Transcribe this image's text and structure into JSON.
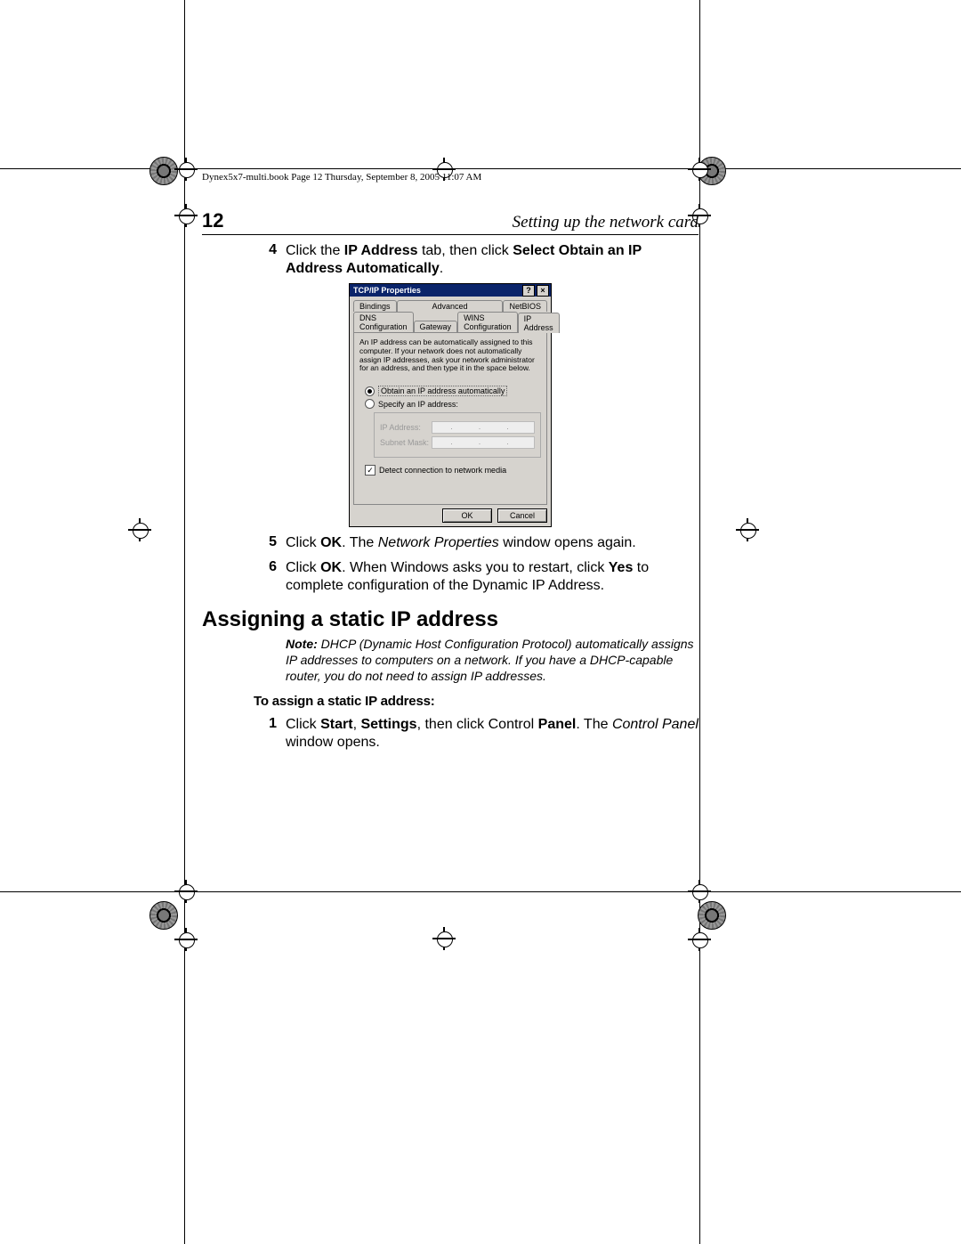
{
  "bookline": "Dynex5x7-multi.book  Page 12  Thursday, September 8, 2005  11:07 AM",
  "header": {
    "page_number": "12",
    "section_title": "Setting up the network card"
  },
  "step4": {
    "number": "4",
    "pre": "Click the ",
    "bold1": "IP Address",
    "mid": " tab, then click ",
    "bold2": "Select Obtain an IP Address Automatically",
    "post": "."
  },
  "dialog": {
    "title": "TCP/IP Properties",
    "help_btn": "?",
    "close_btn": "×",
    "tabs_row1": [
      "Bindings",
      "Advanced",
      "NetBIOS"
    ],
    "tabs_row2": [
      "DNS Configuration",
      "Gateway",
      "WINS Configuration",
      "IP Address"
    ],
    "active_tab": "IP Address",
    "desc": "An IP address can be automatically assigned to this computer. If your network does not automatically assign IP addresses, ask your network administrator for an address, and then type it in the space below.",
    "radio_auto": "Obtain an IP address automatically",
    "radio_specify": "Specify an IP address:",
    "field_ip": "IP Address:",
    "field_mask": "Subnet Mask:",
    "placeholder_dots": ". . .",
    "check_detect": "Detect connection to network media",
    "ok": "OK",
    "cancel": "Cancel"
  },
  "step5": {
    "number": "5",
    "pre": "Click ",
    "bold1": "OK",
    "mid": ". The ",
    "ital1": "Network Properties",
    "post": " window opens again."
  },
  "step6": {
    "number": "6",
    "pre": "Click ",
    "bold1": "OK",
    "mid": ". When Windows asks you to restart, click ",
    "bold2": "Yes",
    "post": " to complete configuration of the Dynamic IP Address."
  },
  "heading2": "Assigning a static IP address",
  "note": {
    "lead": "Note:",
    "body": " DHCP (Dynamic Host Configuration Protocol) automatically assigns IP addresses to computers on a network. If you have a DHCP-capable router, you do not need to assign IP addresses."
  },
  "subhead": "To assign a static IP address:",
  "step1b": {
    "number": "1",
    "pre": "Click ",
    "bold1": "Start",
    "mid1": ", ",
    "bold2": "Settings",
    "mid2": ", then click Control ",
    "bold3": "Panel",
    "mid3": ". The ",
    "ital1": "Control Panel",
    "post": " window opens."
  }
}
